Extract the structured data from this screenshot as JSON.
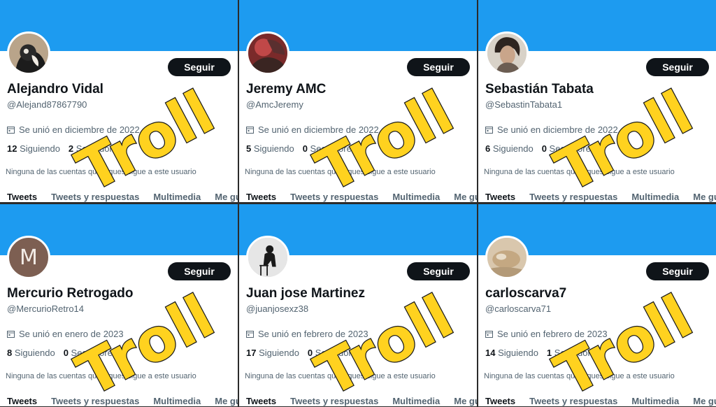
{
  "troll_label": "Troll",
  "tabs": [
    "Tweets",
    "Tweets y respuestas",
    "Multimedia",
    "Me gusta"
  ],
  "follow_label": "Seguir",
  "colors": {
    "banner": "#1d9bf0",
    "troll_fill": "#ffd21f",
    "troll_stroke": "#1a1a1a"
  },
  "cards": [
    {
      "name": "Alejandro Vidal",
      "handle": "@Alejand87867790",
      "joined": "Se unió en diciembre de 2022",
      "following_count": "12",
      "following_label": "Siguiendo",
      "followers_count": "2",
      "followers_label": "Seguidores",
      "mutual": "Ninguna de las cuentas que sigues sigue a este usuario",
      "avatar": "cat-photo"
    },
    {
      "name": "Jeremy AMC",
      "handle": "@AmcJeremy",
      "joined": "Se unió en diciembre de 2022",
      "following_count": "5",
      "following_label": "Siguiendo",
      "followers_count": "0",
      "followers_label": "Seguidores",
      "mutual": "Ninguna de las cuentas que sigues sigue a este usuario",
      "avatar": "red-photo"
    },
    {
      "name": "Sebastián Tabata",
      "handle": "@SebastinTabata1",
      "joined": "Se unió en diciembre de 2022",
      "following_count": "6",
      "following_label": "Siguiendo",
      "followers_count": "0",
      "followers_label": "Seguidores",
      "mutual": "Ninguna de las cuentas que sigues sigue a este usuario",
      "avatar": "portrait-photo"
    },
    {
      "name": "Mercurio Retrogado",
      "handle": "@MercurioRetro14",
      "joined": "Se unió en enero de 2023",
      "following_count": "8",
      "following_label": "Siguiendo",
      "followers_count": "0",
      "followers_label": "Seguidores",
      "mutual": "Ninguna de las cuentas que sigues sigue a este usuario",
      "avatar": "letter-avatar",
      "avatar_letter": "M"
    },
    {
      "name": "Juan jose Martinez",
      "handle": "@juanjosexz38",
      "joined": "Se unió en febrero de 2023",
      "following_count": "17",
      "following_label": "Siguiendo",
      "followers_count": "0",
      "followers_label": "Seguidores",
      "mutual": "Ninguna de las cuentas que sigues sigue a este usuario",
      "avatar": "silhouette-photo"
    },
    {
      "name": "carloscarva7",
      "handle": "@carloscarva71",
      "joined": "Se unió en febrero de 2023",
      "following_count": "14",
      "following_label": "Siguiendo",
      "followers_count": "1",
      "followers_label": "Seguidor",
      "mutual": "Ninguna de las cuentas que sigues sigue a este usuario",
      "avatar": "beige-photo"
    }
  ]
}
